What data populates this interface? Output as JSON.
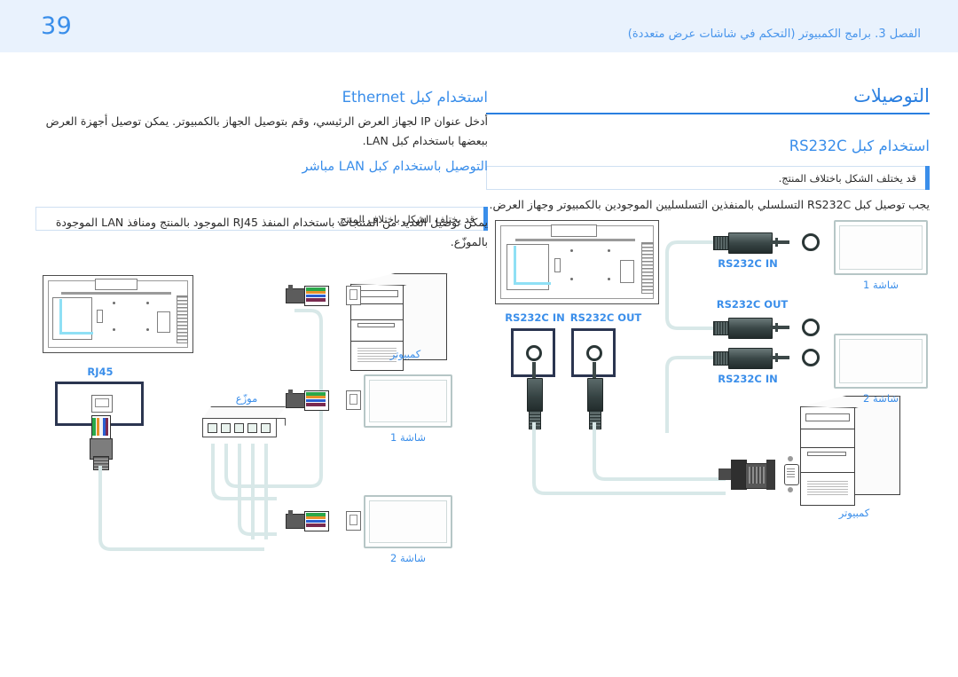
{
  "header": {
    "page_number": "39",
    "chapter_title": "الفصل 3. برامج الكمبيوتر (التحكم في شاشات عرض متعددة)",
    "band_color": "#e9f2fd",
    "accent_color": "#3a8eea"
  },
  "left_column": {
    "heading": "استخدام كبل Ethernet",
    "body": "أدخل عنوان IP لجهاز العرض الرئيسي، وقم بتوصيل الجهاز بالكمبيوتر. يمكن توصيل أجهزة العرض ببعضها باستخدام كبل LAN.",
    "subheading": "التوصيل باستخدام كبل LAN مباشر",
    "note": "قد يختلف الشكل باختلاف المنتج.",
    "body2": "يمكن توصيل العديد من المنتجات باستخدام المنفذ RJ45 الموجود بالمنتج ومنافذ LAN الموجودة بالموزّع.",
    "diagram_labels": {
      "rj45": "RJ45",
      "hub": "موزّع",
      "computer": "كمبيوتر",
      "screen1": "شاشة 1",
      "screen2": "شاشة 2"
    }
  },
  "right_column": {
    "title": "التوصيلات",
    "heading": "استخدام كبل RS232C",
    "note": "قد يختلف الشكل باختلاف المنتج.",
    "body": "يجب توصيل كبل RS232C التسلسلي بالمنفذين التسلسليين الموجودين بالكمبيوتر وجهاز العرض.",
    "diagram_labels": {
      "port_in": "RS232C IN",
      "port_out": "RS232C OUT",
      "plug_in_1": "RS232C IN",
      "plug_out": "RS232C OUT",
      "plug_in_2": "RS232C IN",
      "screen1": "شاشة 1",
      "screen2": "شاشة 2",
      "computer": "كمبيوتر"
    }
  },
  "colors": {
    "heading_blue": "#3a8eea",
    "title_blue": "#2a7fe0",
    "label_blue": "#3a8eea",
    "cable": "#d8e8e8",
    "highlight_cyan": "#8fe0f5",
    "note_border": "#cfe0f2"
  }
}
